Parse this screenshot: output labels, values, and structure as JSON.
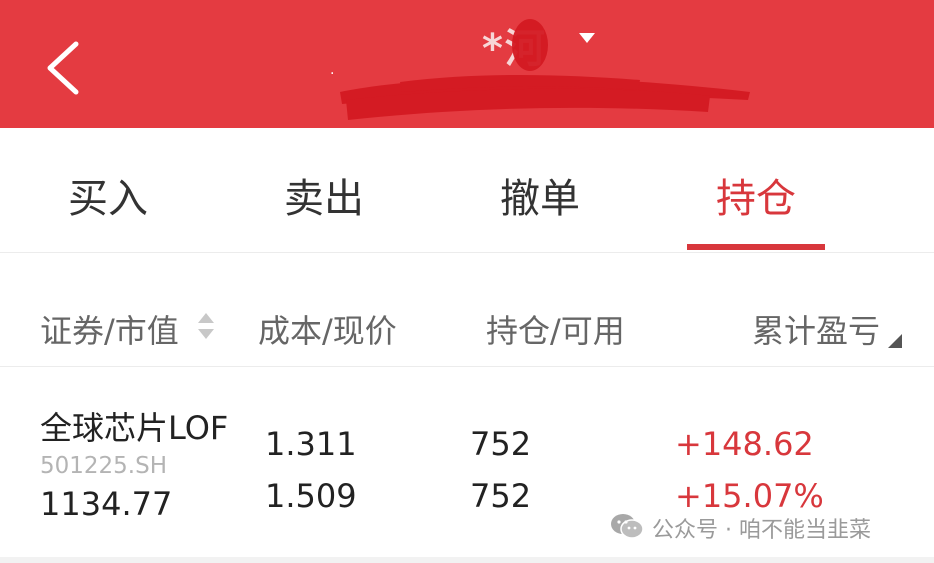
{
  "header": {
    "title": "*河",
    "subtitle": "·",
    "back_icon": "chevron-left-icon",
    "dropdown_icon": "caret-down-icon",
    "background_color": "#e43b41"
  },
  "tabs": [
    {
      "label": "买入",
      "active": false
    },
    {
      "label": "卖出",
      "active": false
    },
    {
      "label": "撤单",
      "active": false
    },
    {
      "label": "持仓",
      "active": true
    }
  ],
  "accent_color": "#d8373c",
  "columns": {
    "security_market_value": "证券/市值",
    "cost_price": "成本/现价",
    "position_available": "持仓/可用",
    "cumulative_pnl": "累计盈亏"
  },
  "holdings": [
    {
      "name": "全球芯片LOF",
      "code": "501225.SH",
      "market_value": "1134.77",
      "cost": "1.311",
      "price": "1.509",
      "position": "752",
      "available": "752",
      "pnl": "+148.62",
      "pnl_percent": "+15.07%"
    }
  ],
  "watermark": {
    "text": "公众号 · 咱不能当韭菜",
    "icon": "wechat-icon"
  }
}
